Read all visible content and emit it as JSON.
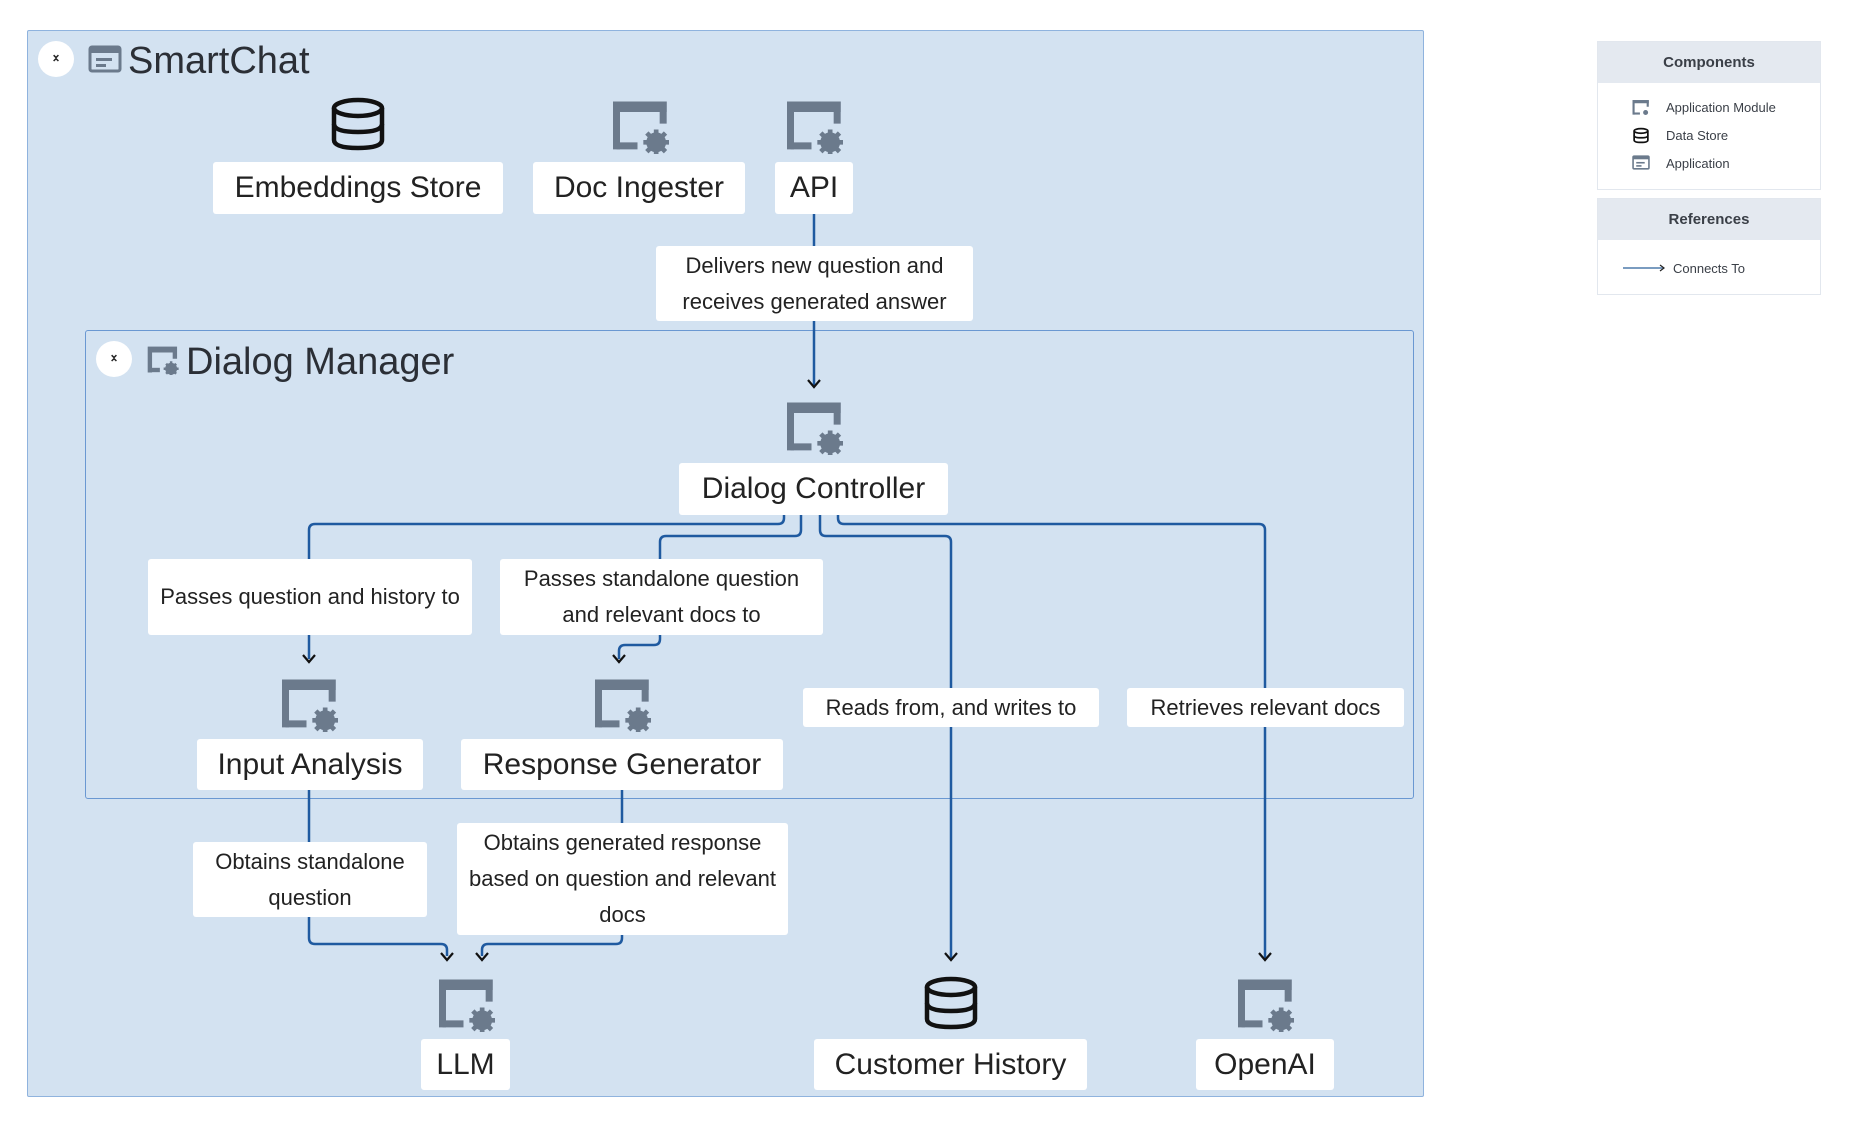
{
  "diagram": {
    "outer_group": {
      "title": "SmartChat",
      "icon": "application-icon"
    },
    "inner_group": {
      "title": "Dialog Manager",
      "icon": "application-module-icon"
    },
    "nodes": {
      "embeddings_store": {
        "label": "Embeddings Store",
        "icon": "data-store-icon"
      },
      "doc_ingester": {
        "label": "Doc Ingester",
        "icon": "application-module-icon"
      },
      "api": {
        "label": "API",
        "icon": "application-module-icon"
      },
      "dialog_controller": {
        "label": "Dialog Controller",
        "icon": "application-module-icon"
      },
      "input_analysis": {
        "label": "Input Analysis",
        "icon": "application-module-icon"
      },
      "response_generator": {
        "label": "Response Generator",
        "icon": "application-module-icon"
      },
      "llm": {
        "label": "LLM",
        "icon": "application-module-icon"
      },
      "customer_history": {
        "label": "Customer History",
        "icon": "data-store-icon"
      },
      "openai": {
        "label": "OpenAI",
        "icon": "application-module-icon"
      }
    },
    "edges": {
      "api_to_dc": {
        "from": "API",
        "to": "Dialog Controller",
        "label": "Delivers new question and receives generated answer"
      },
      "dc_to_ia": {
        "from": "Dialog Controller",
        "to": "Input Analysis",
        "label": "Passes question and history to"
      },
      "dc_to_rg": {
        "from": "Dialog Controller",
        "to": "Response Generator",
        "label": "Passes standalone question and relevant docs to"
      },
      "dc_to_ch": {
        "from": "Dialog Controller",
        "to": "Customer History",
        "label": "Reads from, and writes to"
      },
      "dc_to_openai": {
        "from": "Dialog Controller",
        "to": "OpenAI",
        "label": "Retrieves relevant docs"
      },
      "ia_to_llm": {
        "from": "Input Analysis",
        "to": "LLM",
        "label": "Obtains standalone question"
      },
      "rg_to_llm": {
        "from": "Response Generator",
        "to": "LLM",
        "label": "Obtains generated response based on question and relevant docs"
      }
    }
  },
  "legend": {
    "components": {
      "title": "Components",
      "items": [
        {
          "label": "Application Module",
          "icon": "application-module-icon"
        },
        {
          "label": "Data Store",
          "icon": "data-store-icon"
        },
        {
          "label": "Application",
          "icon": "application-icon"
        }
      ]
    },
    "references": {
      "title": "References",
      "items": [
        {
          "label": "Connects To",
          "icon": "arrow-line-icon"
        }
      ]
    }
  },
  "colors": {
    "group_fill": "#d3e2f1",
    "group_border": "#8fb3de",
    "edge": "#1f5aa0",
    "icon_gray": "#6b7a8c"
  }
}
